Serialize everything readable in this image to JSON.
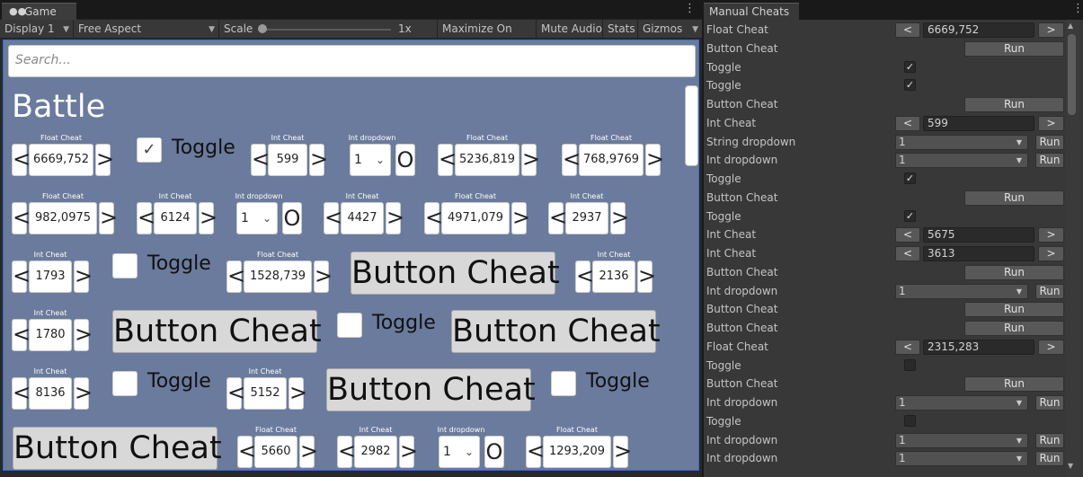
{
  "game": {
    "tab_label": "Game",
    "toolbar": {
      "display": "Display 1",
      "aspect": "Free Aspect",
      "scale_label": "Scale",
      "scale_value": "1x",
      "maximize": "Maximize On Play",
      "mute": "Mute Audio",
      "stats": "Stats",
      "gizmos": "Gizmos"
    },
    "search_placeholder": "Search...",
    "section_title": "Battle",
    "widgets": {
      "float1": {
        "caption": "Float Cheat",
        "value": "6669,752"
      },
      "toggle1": {
        "label": "Toggle",
        "checked": true
      },
      "int1": {
        "caption": "Int Cheat",
        "value": "599"
      },
      "dd1": {
        "caption": "Int dropdown",
        "value": "1",
        "o": "O"
      },
      "float2": {
        "caption": "Float Cheat",
        "value": "5236,819"
      },
      "float3": {
        "caption": "Float Cheat",
        "value": "768,9769"
      },
      "float4": {
        "caption": "Float Cheat",
        "value": "982,0975"
      },
      "int2": {
        "caption": "Int Cheat",
        "value": "6124"
      },
      "dd2": {
        "caption": "Int dropdown",
        "value": "1",
        "o": "O"
      },
      "int3": {
        "caption": "Int Cheat",
        "value": "4427"
      },
      "float5": {
        "caption": "Float Cheat",
        "value": "4971,079"
      },
      "int4": {
        "caption": "Int Cheat",
        "value": "2937"
      },
      "int5": {
        "caption": "Int Cheat",
        "value": "1793"
      },
      "toggle2": {
        "label": "Toggle",
        "checked": false
      },
      "float6": {
        "caption": "Float Cheat",
        "value": "1528,739"
      },
      "button1": {
        "label": "Button Cheat"
      },
      "int6": {
        "caption": "Int Cheat",
        "value": "2136"
      },
      "int7": {
        "caption": "Int Cheat",
        "value": "1780"
      },
      "button2": {
        "label": "Button Cheat"
      },
      "toggle3": {
        "label": "Toggle",
        "checked": false
      },
      "button3": {
        "label": "Button Cheat"
      },
      "int8": {
        "caption": "Int Cheat",
        "value": "8136"
      },
      "toggle4": {
        "label": "Toggle",
        "checked": false
      },
      "int9": {
        "caption": "Int Cheat",
        "value": "5152"
      },
      "button4": {
        "label": "Button Cheat"
      },
      "toggle5": {
        "label": "Toggle",
        "checked": false
      },
      "button5": {
        "label": "Button Cheat"
      },
      "float7": {
        "caption": "Float Cheat",
        "value": "5660"
      },
      "int10": {
        "caption": "Int Cheat",
        "value": "2982"
      },
      "dd3": {
        "caption": "Int dropdown",
        "value": "1",
        "o": "O"
      },
      "float8": {
        "caption": "Float Cheat",
        "value": "1293,209"
      }
    },
    "arrow_left": "<",
    "arrow_right": ">"
  },
  "cheats": {
    "tab_label": "Manual Cheats",
    "run_label": "Run",
    "dec_label": "<",
    "inc_label": ">",
    "rows": [
      {
        "label": "Float Cheat",
        "kind": "number",
        "value": "6669,752"
      },
      {
        "label": "Button Cheat",
        "kind": "button"
      },
      {
        "label": "Toggle",
        "kind": "toggle",
        "checked": true
      },
      {
        "label": "Toggle",
        "kind": "toggle",
        "checked": true
      },
      {
        "label": "Button Cheat",
        "kind": "button"
      },
      {
        "label": "Int Cheat",
        "kind": "number",
        "value": "599"
      },
      {
        "label": "String dropdown",
        "kind": "dropdown",
        "value": "1"
      },
      {
        "label": "Int dropdown",
        "kind": "dropdown",
        "value": "1"
      },
      {
        "label": "Toggle",
        "kind": "toggle",
        "checked": true
      },
      {
        "label": "Button Cheat",
        "kind": "button"
      },
      {
        "label": "Toggle",
        "kind": "toggle",
        "checked": true
      },
      {
        "label": "Int Cheat",
        "kind": "number",
        "value": "5675"
      },
      {
        "label": "Int Cheat",
        "kind": "number",
        "value": "3613"
      },
      {
        "label": "Button Cheat",
        "kind": "button"
      },
      {
        "label": "Int dropdown",
        "kind": "dropdown",
        "value": "1"
      },
      {
        "label": "Button Cheat",
        "kind": "button"
      },
      {
        "label": "Button Cheat",
        "kind": "button"
      },
      {
        "label": "Float Cheat",
        "kind": "number",
        "value": "2315,283"
      },
      {
        "label": "Toggle",
        "kind": "toggle",
        "checked": false
      },
      {
        "label": "Button Cheat",
        "kind": "button"
      },
      {
        "label": "Int dropdown",
        "kind": "dropdown",
        "value": "1"
      },
      {
        "label": "Toggle",
        "kind": "toggle",
        "checked": false
      },
      {
        "label": "Int dropdown",
        "kind": "dropdown",
        "value": "1"
      },
      {
        "label": "Int dropdown",
        "kind": "dropdown",
        "value": "1"
      }
    ]
  }
}
